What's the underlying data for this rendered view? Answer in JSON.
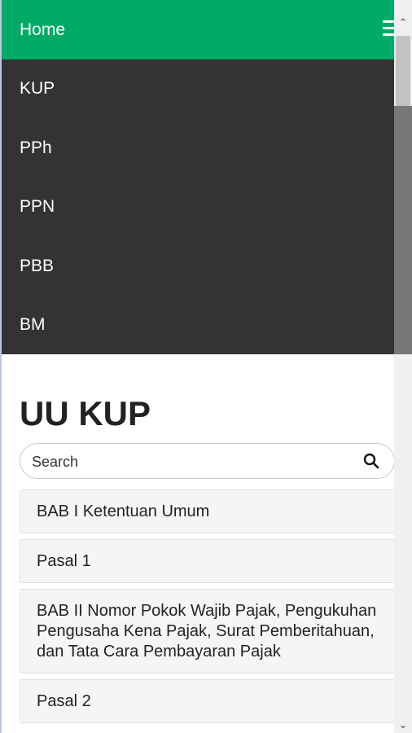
{
  "header": {
    "title": "Home",
    "menu_icon": "hamburger-menu-icon"
  },
  "nav": {
    "items": [
      {
        "label": "KUP"
      },
      {
        "label": "PPh"
      },
      {
        "label": "PPN"
      },
      {
        "label": "PBB"
      },
      {
        "label": "BM"
      }
    ]
  },
  "main": {
    "title": "UU KUP",
    "search": {
      "placeholder": "Search",
      "value": "",
      "icon": "search-icon"
    },
    "entries": [
      {
        "label": "BAB I Ketentuan Umum"
      },
      {
        "label": "Pasal 1"
      },
      {
        "label": "BAB II Nomor Pokok Wajib Pajak, Pengukuhan Pengusaha Kena Pajak, Surat Pemberitahuan, dan Tata Cara Pembayaran Pajak"
      },
      {
        "label": "Pasal 2"
      }
    ]
  },
  "colors": {
    "header_bg": "#02aa68",
    "nav_bg": "#333333",
    "entry_bg": "#f5f5f5"
  }
}
